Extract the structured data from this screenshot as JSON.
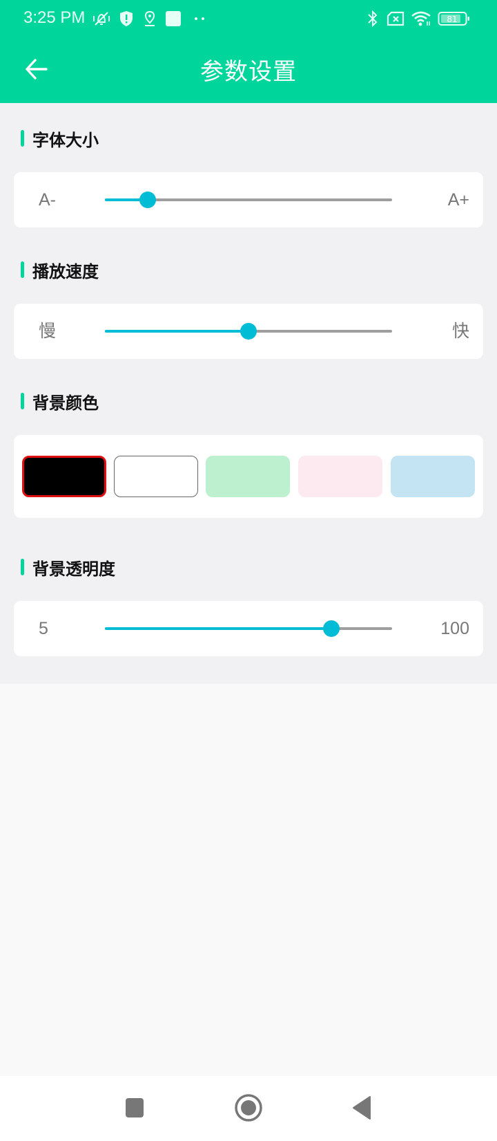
{
  "status_bar": {
    "time": "3:25 PM",
    "left_icons": [
      "vibrate-mute-icon",
      "shield-alert-icon",
      "location-icon",
      "app-square-icon",
      "more-dots-icon"
    ],
    "right_icons": [
      "bluetooth-icon",
      "no-sim-icon",
      "wifi-icon",
      "battery-icon"
    ],
    "battery_level": "81"
  },
  "app_bar": {
    "title": "参数设置",
    "back_icon": "arrow-left-icon"
  },
  "sections": {
    "font_size": {
      "title": "字体大小",
      "min_label": "A-",
      "max_label": "A+",
      "value_fraction": 0.15
    },
    "play_speed": {
      "title": "播放速度",
      "min_label": "慢",
      "max_label": "快",
      "value_fraction": 0.5
    },
    "background_color": {
      "title": "背景颜色",
      "selected_index": 0,
      "options": [
        {
          "name": "black",
          "color": "#000000"
        },
        {
          "name": "white",
          "color": "#ffffff"
        },
        {
          "name": "green",
          "color": "#bdf0cf"
        },
        {
          "name": "pink",
          "color": "#fde9f0"
        },
        {
          "name": "blue",
          "color": "#c4e3f3"
        }
      ]
    },
    "background_opacity": {
      "title": "背景透明度",
      "min_label": "5",
      "max_label": "100",
      "min": 5,
      "max": 100,
      "value": 80
    }
  },
  "colors": {
    "accent": "#00d69b",
    "slider_active": "#00bcd4",
    "slider_inactive": "#9e9e9e",
    "selected_border": "#e01010"
  },
  "nav_bar": {
    "buttons": [
      "recents-square-icon",
      "home-circle-icon",
      "back-triangle-icon"
    ]
  }
}
